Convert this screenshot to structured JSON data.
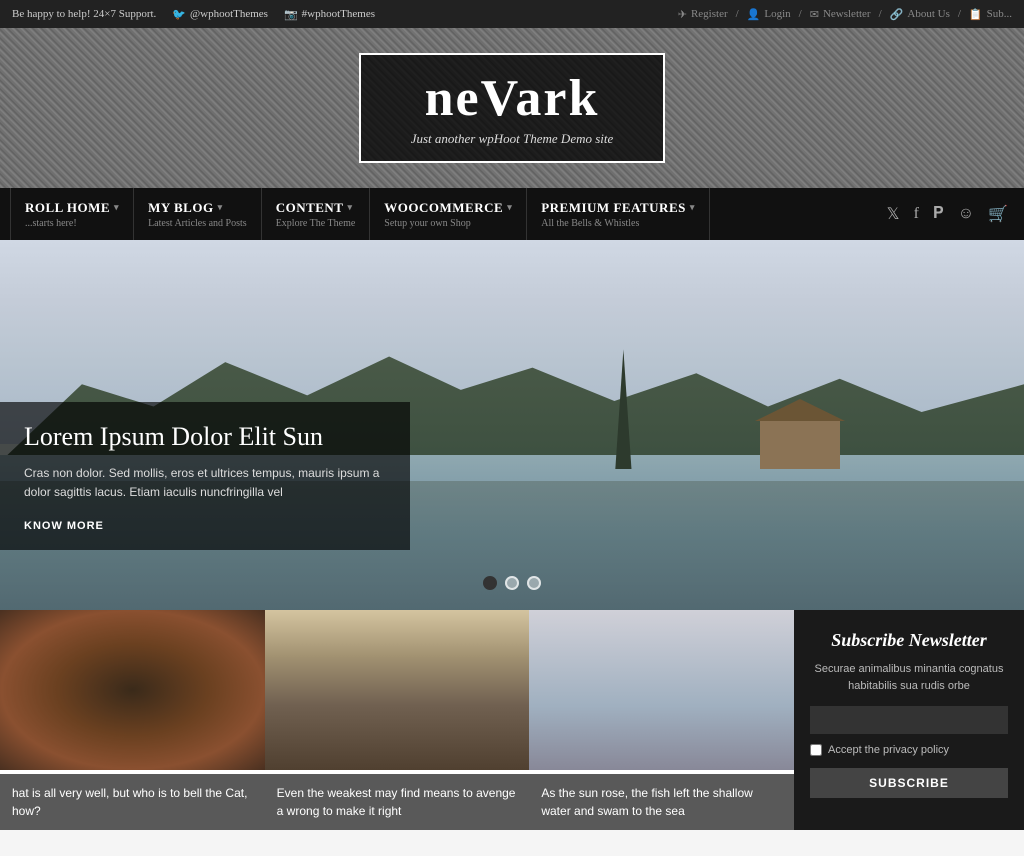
{
  "topbar": {
    "support_text": "Be happy to help! 24×7 Support.",
    "twitter_handle": "@wphootThemes",
    "instagram_handle": "#wphootThemes",
    "register": "Register",
    "login": "Login",
    "newsletter": "Newsletter",
    "about_us": "About Us",
    "subscribe": "Sub..."
  },
  "logo": {
    "name_part1": "ne",
    "name_part2": "V",
    "name_part3": "ark",
    "tagline": "Just another wpHoot Theme Demo site"
  },
  "nav": {
    "items": [
      {
        "title": "ROLL HOME",
        "subtitle": "...starts here!",
        "has_dropdown": true
      },
      {
        "title": "MY BLOG",
        "subtitle": "Latest Articles and Posts",
        "has_dropdown": true
      },
      {
        "title": "CONTENT",
        "subtitle": "Explore The Theme",
        "has_dropdown": true
      },
      {
        "title": "WOOCOMMERCE",
        "subtitle": "Setup your own Shop",
        "has_dropdown": true
      },
      {
        "title": "PREMIUM FEATURES",
        "subtitle": "All the Bells & Whistles",
        "has_dropdown": true
      }
    ],
    "social_icons": [
      "twitter",
      "facebook",
      "pinterest",
      "tripadvisor",
      "cart"
    ]
  },
  "hero": {
    "title": "Lorem Ipsum Dolor Elit Sun",
    "description": "Cras non dolor. Sed mollis, eros et ultrices tempus, mauris ipsum a dolor sagittis lacus. Etiam iaculis nuncfringilla vel",
    "cta_label": "KNOW MORE",
    "dots": [
      {
        "active": true
      },
      {
        "active": false
      },
      {
        "active": false
      }
    ]
  },
  "cards": [
    {
      "caption": "hat is all very well, but who is to bell the Cat, how?"
    },
    {
      "caption": "Even the weakest may find means to avenge a wrong to make it right"
    },
    {
      "caption": "As the sun rose, the fish left the shallow water and swam to the sea"
    }
  ],
  "newsletter": {
    "title": "Subscribe Newsletter",
    "description": "Securae animalibus minantia cognatus habitabilis sua rudis orbe",
    "input_placeholder": "",
    "privacy_label": "Accept the privacy policy",
    "button_label": "SUBSCRIBE"
  }
}
